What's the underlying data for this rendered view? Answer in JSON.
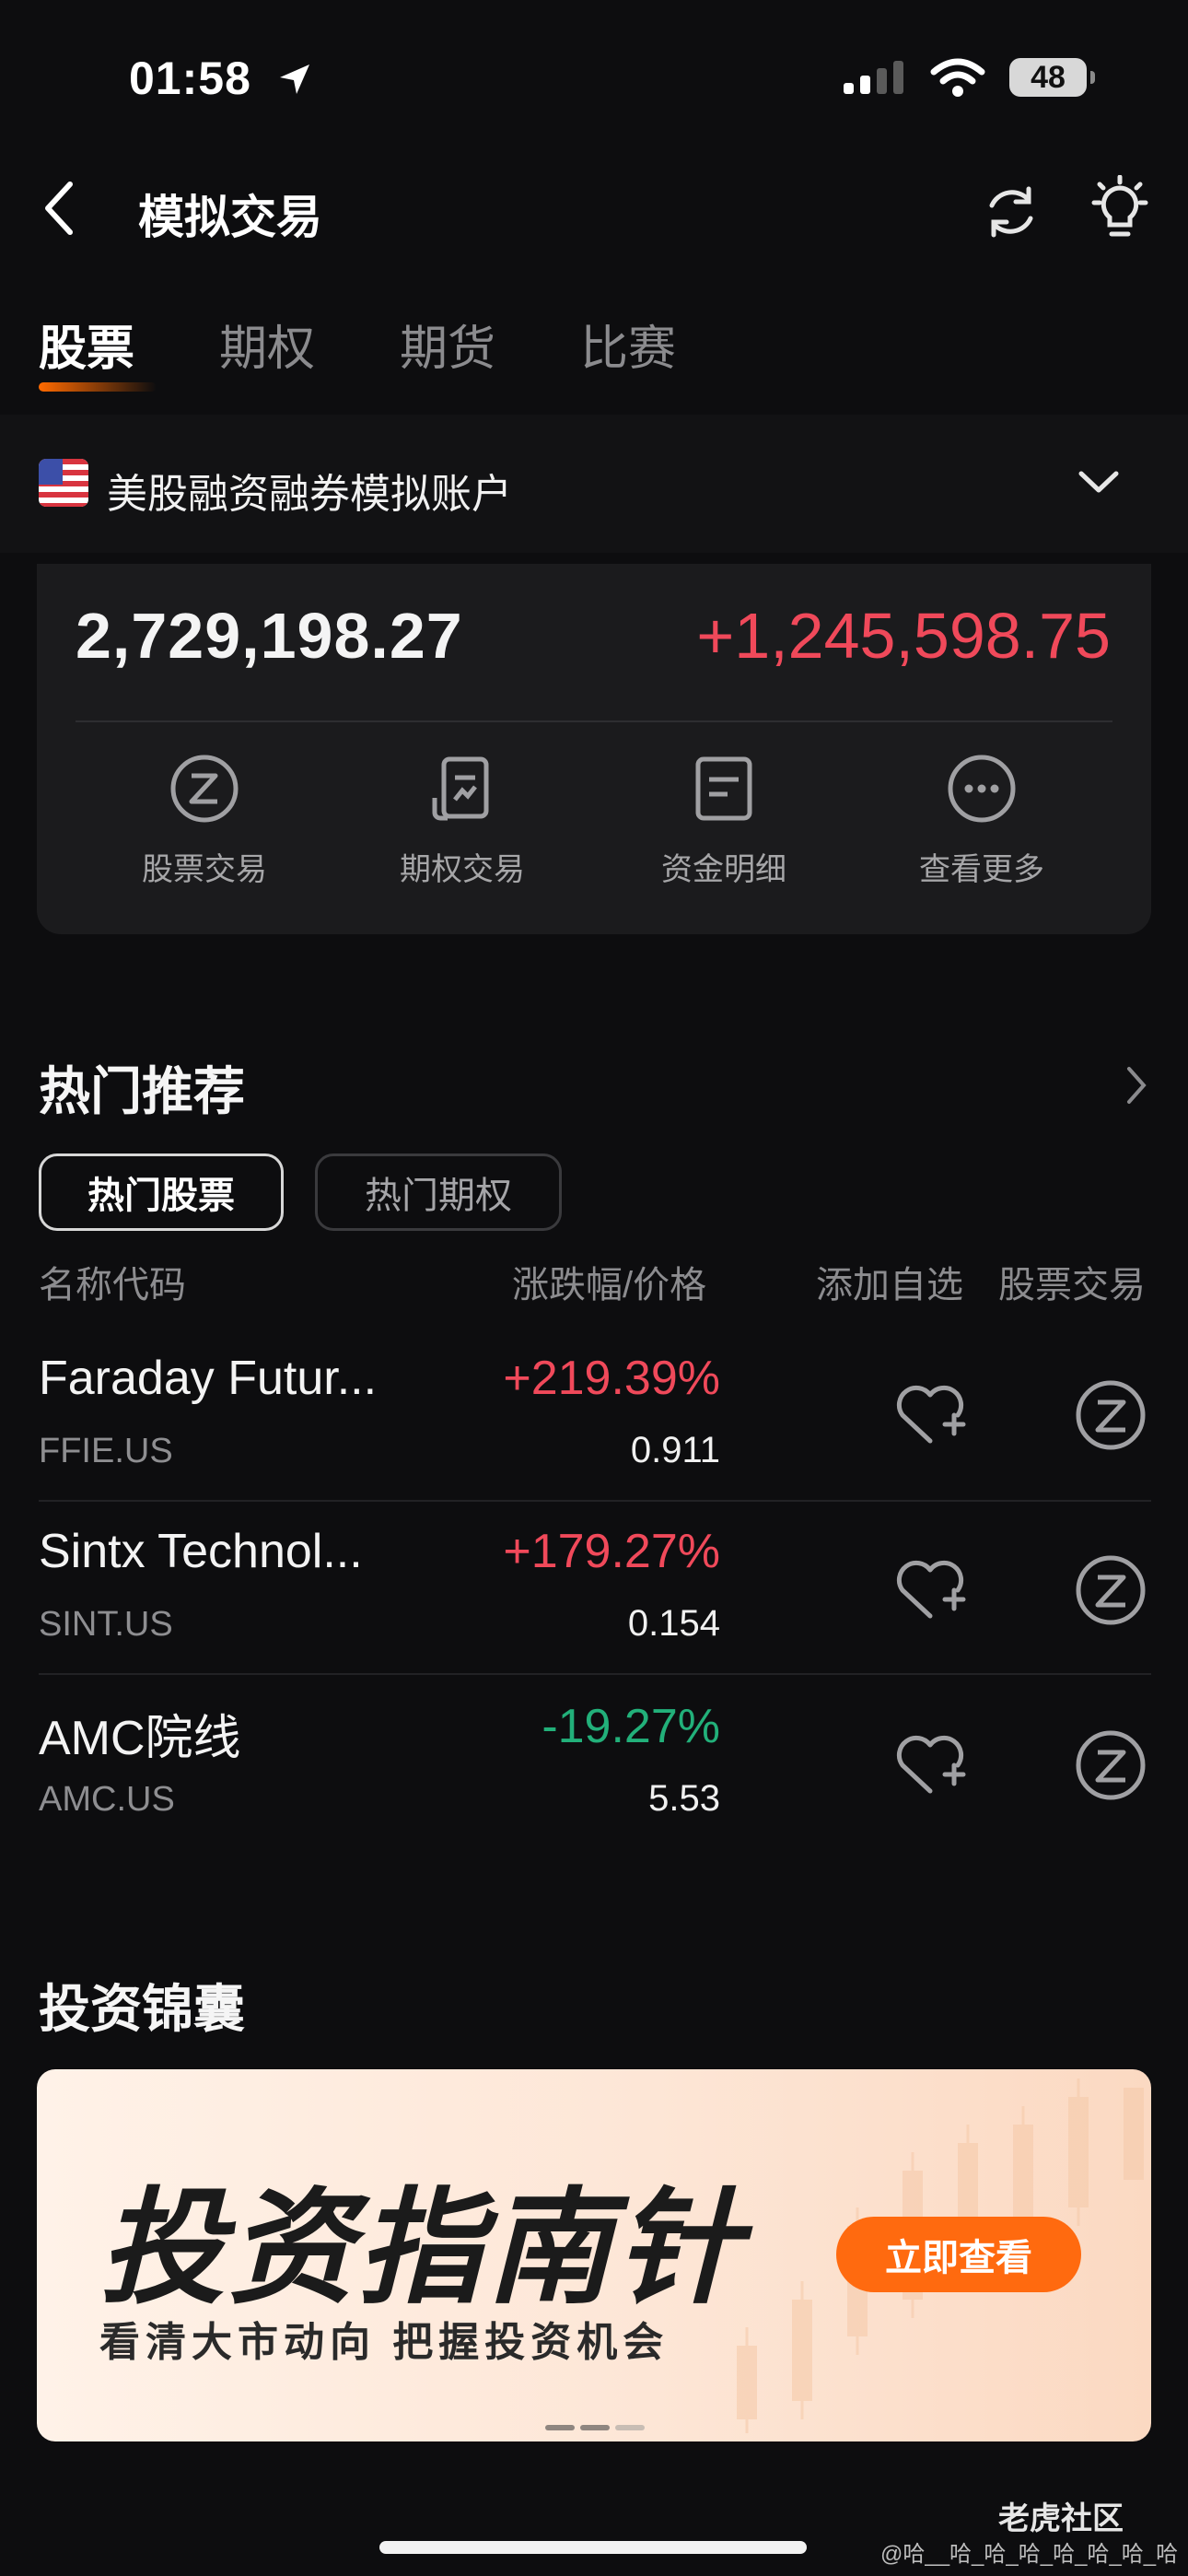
{
  "status_bar": {
    "time": "01:58",
    "battery": "48"
  },
  "nav": {
    "title": "模拟交易"
  },
  "tabs": [
    {
      "label": "股票"
    },
    {
      "label": "期权"
    },
    {
      "label": "期货"
    },
    {
      "label": "比赛"
    }
  ],
  "account": {
    "name": "美股融资融券模拟账户"
  },
  "summary": {
    "total_assets": "2,729,198.27",
    "pnl": "+1,245,598.75",
    "actions": [
      {
        "label": "股票交易",
        "icon": "trade-icon"
      },
      {
        "label": "期权交易",
        "icon": "option-icon"
      },
      {
        "label": "资金明细",
        "icon": "document-icon"
      },
      {
        "label": "查看更多",
        "icon": "more-icon"
      }
    ]
  },
  "hot": {
    "title": "热门推荐",
    "filters": [
      {
        "label": "热门股票"
      },
      {
        "label": "热门期权"
      }
    ],
    "columns": {
      "name": "名称代码",
      "change": "涨跌幅/价格",
      "watch": "添加自选",
      "trade": "股票交易"
    },
    "stocks": [
      {
        "name": "Faraday Futur...",
        "code": "FFIE.US",
        "change": "+219.39%",
        "price": "0.911",
        "direction": "up"
      },
      {
        "name": "Sintx Technol...",
        "code": "SINT.US",
        "change": "+179.27%",
        "price": "0.154",
        "direction": "up"
      },
      {
        "name": "AMC院线",
        "code": "AMC.US",
        "change": "-19.27%",
        "price": "5.53",
        "direction": "down"
      }
    ]
  },
  "invest": {
    "title": "投资锦囊",
    "banner": {
      "title": "投资指南针",
      "subtitle": "看清大市动向  把握投资机会",
      "button": "立即查看"
    }
  },
  "watermark": {
    "brand": "老虎社区",
    "user": "@哈__哈_哈_哈_哈_哈_哈_哈"
  },
  "colors": {
    "up": "#f0495a",
    "down": "#22b07a",
    "accent": "#ff6a0f",
    "background": "#0d0d0f"
  }
}
